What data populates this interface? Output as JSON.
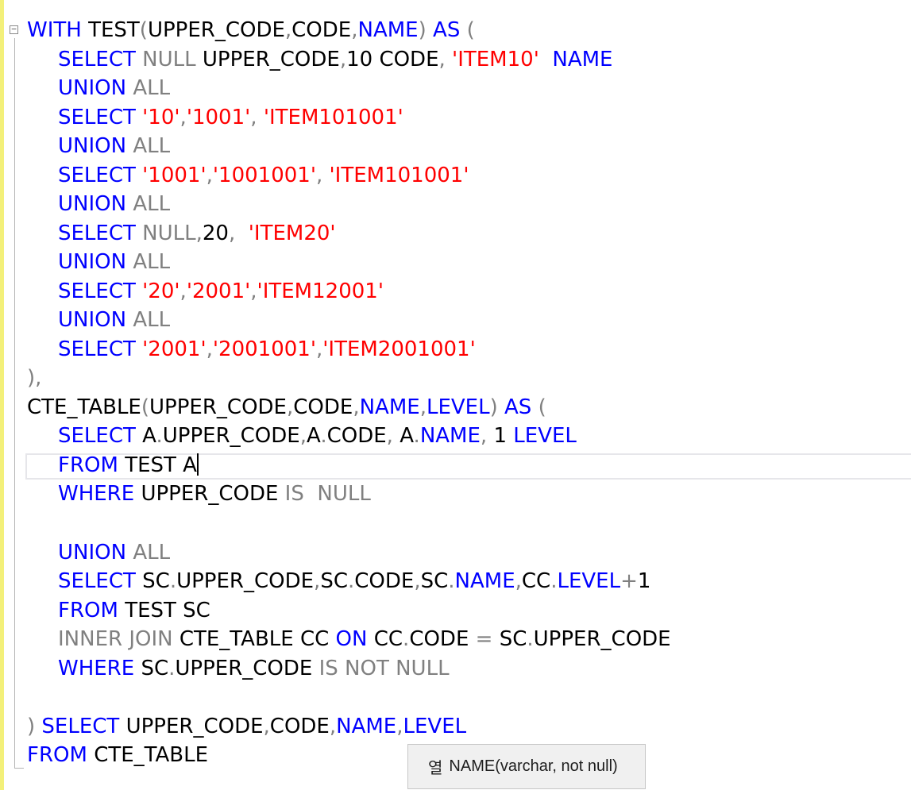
{
  "editor": {
    "tooltip": {
      "icon_char": "열",
      "text": "NAME(varchar, not null)"
    },
    "lines": [
      [
        "WITH TEST(UPPER_CODE,CODE,NAME) AS ("
      ],
      [
        "SELECT NULL UPPER_CODE,10 CODE, 'ITEM10'  NAME"
      ],
      [
        "UNION ALL"
      ],
      [
        "SELECT '10','1001', 'ITEM101001'"
      ],
      [
        "UNION ALL"
      ],
      [
        "SELECT '1001','1001001', 'ITEM101001'"
      ],
      [
        "UNION ALL"
      ],
      [
        "SELECT NULL,20,  'ITEM20'"
      ],
      [
        "UNION ALL"
      ],
      [
        "SELECT '20','2001','ITEM12001'"
      ],
      [
        "UNION ALL"
      ],
      [
        "SELECT '2001','2001001','ITEM2001001'"
      ],
      [
        "),"
      ],
      [
        "CTE_TABLE(UPPER_CODE,CODE,NAME,LEVEL) AS ("
      ],
      [
        "SELECT A.UPPER_CODE,A.CODE, A.NAME, 1 LEVEL"
      ],
      [
        "FROM TEST A"
      ],
      [
        "WHERE UPPER_CODE IS  NULL"
      ],
      [
        ""
      ],
      [
        "UNION ALL"
      ],
      [
        "SELECT SC.UPPER_CODE,SC.CODE,SC.NAME,CC.LEVEL+1"
      ],
      [
        "FROM TEST SC"
      ],
      [
        "INNER JOIN CTE_TABLE CC ON CC.CODE = SC.UPPER_CODE"
      ],
      [
        "WHERE SC.UPPER_CODE IS NOT NULL"
      ],
      [
        ""
      ],
      [
        ") SELECT UPPER_CODE,CODE,NAME,LEVEL"
      ],
      [
        "FROM CTE_TABLE"
      ]
    ]
  },
  "colors": {
    "keyword": "#0000ff",
    "operator": "#808080",
    "string": "#ff0000",
    "identifier": "#000000",
    "margin_marker": "#f3f07a"
  },
  "icons": [
    "fold-collapse-icon",
    "column-icon"
  ]
}
